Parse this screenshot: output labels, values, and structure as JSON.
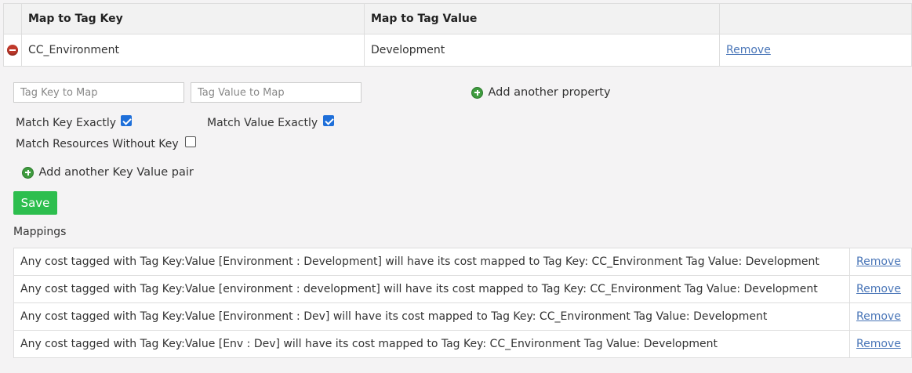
{
  "top_table": {
    "headers": {
      "key": "Map to Tag Key",
      "value": "Map to Tag Value"
    },
    "row": {
      "key": "CC_Environment",
      "value": "Development",
      "action": "Remove"
    }
  },
  "form": {
    "tag_key_placeholder": "Tag Key to Map",
    "tag_value_placeholder": "Tag Value to Map",
    "add_property_label": "Add another property",
    "match_key_label": "Match Key Exactly",
    "match_key_checked": true,
    "match_value_label": "Match Value Exactly",
    "match_value_checked": true,
    "match_without_key_label": "Match Resources Without Key",
    "match_without_key_checked": false,
    "add_pair_label": "Add another Key Value pair",
    "save_label": "Save"
  },
  "mappings": {
    "title": "Mappings",
    "rows": [
      {
        "text": "Any cost tagged with Tag Key:Value [Environment : Development] will have its cost mapped to Tag Key: CC_Environment Tag Value: Development",
        "action": "Remove"
      },
      {
        "text": "Any cost tagged with Tag Key:Value [environment : development] will have its cost mapped to Tag Key: CC_Environment Tag Value: Development",
        "action": "Remove"
      },
      {
        "text": "Any cost tagged with Tag Key:Value [Environment : Dev] will have its cost mapped to Tag Key: CC_Environment Tag Value: Development",
        "action": "Remove"
      },
      {
        "text": "Any cost tagged with Tag Key:Value [Env : Dev] will have its cost mapped to Tag Key: CC_Environment Tag Value: Development",
        "action": "Remove"
      }
    ]
  },
  "colors": {
    "link": "#4a76b8",
    "save_button": "#2dbe4e",
    "checkbox_checked": "#1e6fd9",
    "remove_icon": "#c0392b",
    "add_icon": "#3e9b3e"
  }
}
